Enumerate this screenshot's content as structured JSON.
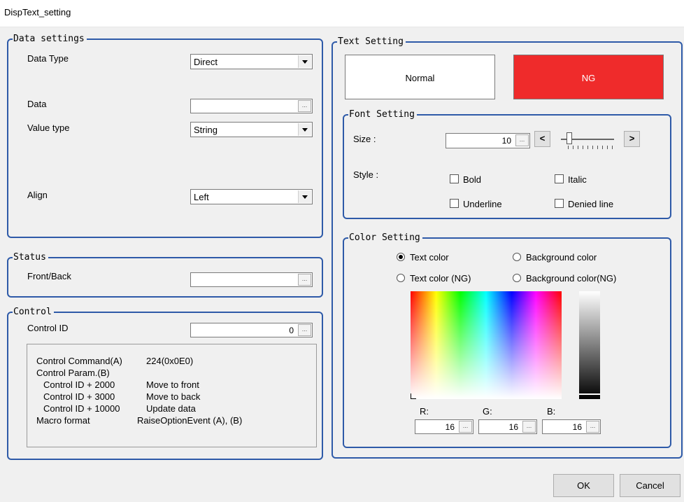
{
  "window": {
    "title": "DispText_setting"
  },
  "data_settings": {
    "legend": "Data settings",
    "data_type_label": "Data Type",
    "data_type_value": "Direct",
    "data_label": "Data",
    "data_value": "",
    "value_type_label": "Value type",
    "value_type_value": "String",
    "align_label": "Align",
    "align_value": "Left"
  },
  "status": {
    "legend": "Status",
    "front_back_label": "Front/Back",
    "front_back_value": ""
  },
  "control": {
    "legend": "Control",
    "control_id_label": "Control ID",
    "control_id_value": "0",
    "rows": [
      {
        "name": "Control Command(A)",
        "value": "224(0x0E0)"
      },
      {
        "name": "Control Param.(B)",
        "value": ""
      },
      {
        "name": "  Control ID + 2000",
        "value": "Move to front"
      },
      {
        "name": "  Control ID + 3000",
        "value": "Move to back"
      },
      {
        "name": "  Control ID + 10000",
        "value": "Update data"
      },
      {
        "name": "Macro format",
        "value": "RaiseOptionEvent (A), (B)"
      }
    ]
  },
  "text_setting": {
    "legend": "Text Setting",
    "normal_label": "Normal",
    "ng_label": "NG",
    "ng_color": "#ef2b2b"
  },
  "font_setting": {
    "legend": "Font Setting",
    "size_label": "Size :",
    "size_value": "10",
    "size_dec": "<",
    "size_inc": ">",
    "size_slider_fraction": 0.1,
    "style_label": "Style :",
    "bold_label": "Bold",
    "italic_label": "Italic",
    "underline_label": "Underline",
    "denied_label": "Denied line"
  },
  "color_setting": {
    "legend": "Color Setting",
    "options": [
      "Text color",
      "Background color",
      "Text color (NG)",
      "Background color(NG)"
    ],
    "selected": "Text color",
    "r_label": "R:",
    "g_label": "G:",
    "b_label": "B:",
    "r_value": "16",
    "g_value": "16",
    "b_value": "16"
  },
  "buttons": {
    "ok": "OK",
    "cancel": "Cancel"
  },
  "icons": {
    "ellipsis": "ellipsis-icon",
    "dropdown": "chevron-down-icon"
  }
}
